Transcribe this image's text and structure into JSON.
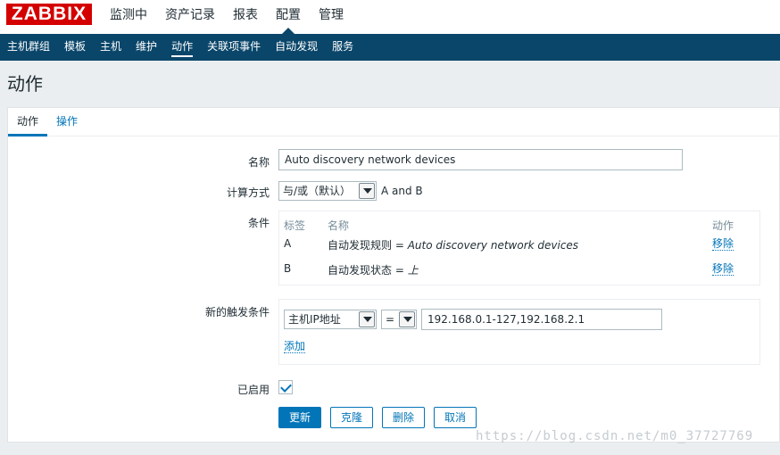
{
  "header": {
    "logo": "ZABBIX",
    "menu": [
      "监测中",
      "资产记录",
      "报表",
      "配置",
      "管理"
    ],
    "active_menu": "配置"
  },
  "submenu": {
    "items": [
      "主机群组",
      "模板",
      "主机",
      "维护",
      "动作",
      "关联项事件",
      "自动发现",
      "服务"
    ],
    "active": "动作"
  },
  "page": {
    "title": "动作"
  },
  "tabs": {
    "action": "动作",
    "operations": "操作"
  },
  "form": {
    "name_label": "名称",
    "name_value": "Auto discovery  network devices",
    "calc_label": "计算方式",
    "calc_value": "与/或（默认）",
    "calc_formula": "A and B",
    "conditions_label": "条件",
    "conditions_header": {
      "label": "标签",
      "name": "名称",
      "action": "动作"
    },
    "conditions": [
      {
        "label": "A",
        "name_prefix": "自动发现规则 = ",
        "name_value": "Auto discovery network devices",
        "action": "移除"
      },
      {
        "label": "B",
        "name_prefix": "自动发现状态 = ",
        "name_value": "上",
        "action": "移除"
      }
    ],
    "new_condition_label": "新的触发条件",
    "new_condition_type": "主机IP地址",
    "new_condition_operator": "=",
    "new_condition_value": "192.168.0.1-127,192.168.2.1",
    "add_link": "添加",
    "enabled_label": "已启用",
    "enabled": true
  },
  "buttons": {
    "update": "更新",
    "clone": "克隆",
    "delete": "删除",
    "cancel": "取消"
  },
  "watermark": "https://blog.csdn.net/m0_37727769",
  "colors": {
    "brand": "#d40000",
    "nav": "#0a466a",
    "accent": "#0275b8"
  }
}
